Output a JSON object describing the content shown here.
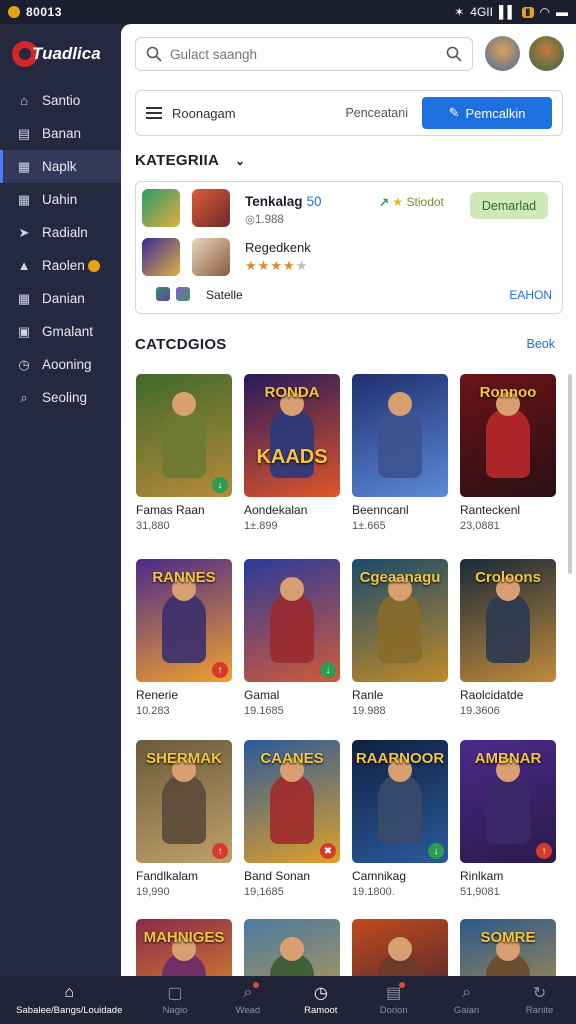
{
  "status": {
    "time": "80013",
    "net": "4GII"
  },
  "app": {
    "name": "Tuadlica"
  },
  "sidebar": {
    "items": [
      {
        "label": "Santio",
        "icon": "home-icon"
      },
      {
        "label": "Banan",
        "icon": "layout-icon"
      },
      {
        "label": "Naplk",
        "icon": "grid-icon",
        "active": true
      },
      {
        "label": "Uahin",
        "icon": "grid-icon"
      },
      {
        "label": "Radialn",
        "icon": "pin-icon"
      },
      {
        "label": "Raolen",
        "icon": "triangle-icon",
        "badge": true
      },
      {
        "label": "Danian",
        "icon": "grid-icon"
      },
      {
        "label": "Gmalant",
        "icon": "image-icon"
      },
      {
        "label": "Aooning",
        "icon": "clock-icon"
      },
      {
        "label": "Seoling",
        "icon": "search-icon"
      }
    ]
  },
  "search": {
    "placeholder": "Gulact saangh"
  },
  "toolbar": {
    "menu_label": "Roonagam",
    "mid_label": "Penceatani",
    "cta_label": "Pemcalkin"
  },
  "featured": {
    "title": "KATEGRIIA",
    "app_name": "Tenkalag",
    "app_tag": "50",
    "meta": "◎1.988",
    "trend_label": "Stiodot",
    "download_label": "Demarlad",
    "second_title": "Regedkenk",
    "rating_filled": 4,
    "rating_total": 5,
    "footer_label": "Satelle",
    "more_label": "EAHON"
  },
  "categories": {
    "title": "CATCDGIOS",
    "see_all": "Beok"
  },
  "games": [
    {
      "name": "Famas Raan",
      "count": "31,880",
      "title": "",
      "bg": [
        "#3e6a2a",
        "#b7893a"
      ],
      "hero": "#6b7a33",
      "chip": "#2e9a52",
      "chip_icon": "↓"
    },
    {
      "name": "Aondekalan",
      "count": "1±.899",
      "title": "KAADS",
      "top": "RONDA",
      "bg": [
        "#261a5c",
        "#e0552a"
      ],
      "hero": "#2a3a7a",
      "chip": "",
      "chip_icon": ""
    },
    {
      "name": "Beenncanl",
      "count": "1±.665",
      "title": "",
      "bg": [
        "#1f2f6e",
        "#5b8ad8"
      ],
      "hero": "#3d5290",
      "chip": "",
      "chip_icon": ""
    },
    {
      "name": "Ranteckenl",
      "count": "23,0881",
      "title": "Ronnoo",
      "bg": [
        "#6a1418",
        "#2a0f14"
      ],
      "hero": "#b8282c",
      "chip": "",
      "chip_icon": ""
    },
    {
      "name": "Renerie",
      "count": "10.283",
      "title": "RANNES",
      "bg": [
        "#4a2a8a",
        "#f0a030"
      ],
      "hero": "#3a2f6e",
      "chip": "#d63a2a",
      "chip_icon": "↑"
    },
    {
      "name": "Gamal",
      "count": "19.1685",
      "title": "",
      "bg": [
        "#2a3a9a",
        "#d05a3a"
      ],
      "hero": "#9a2a30",
      "chip": "#2e9a52",
      "chip_icon": "↓"
    },
    {
      "name": "Ranle",
      "count": "19.988",
      "title": "Cgeaanagu",
      "bg": [
        "#1a4a6a",
        "#c08a2a"
      ],
      "hero": "#8a6a2a",
      "chip": "",
      "chip_icon": ""
    },
    {
      "name": "Raolcidatde",
      "count": "19.3606",
      "title": "Croloons",
      "bg": [
        "#1a2a3a",
        "#c08a3a"
      ],
      "hero": "#2a3850",
      "chip": "",
      "chip_icon": ""
    },
    {
      "name": "Fandlkalam",
      "count": "19,990",
      "title": "SHERMAK",
      "bg": [
        "#6a5a3a",
        "#c0a06a"
      ],
      "hero": "#5a4a3a",
      "chip": "#d63a2a",
      "chip_icon": "↑"
    },
    {
      "name": "Band Sonan",
      "count": "19,1685",
      "title": "CAANES",
      "bg": [
        "#2a5a9a",
        "#e0a02a"
      ],
      "hero": "#a02a2a",
      "chip": "#d63a2a",
      "chip_icon": "✖"
    },
    {
      "name": "Camnikag",
      "count": "19.1800.",
      "title": "RAARNOOR",
      "bg": [
        "#0f2040",
        "#2a5a9a"
      ],
      "hero": "#3a4a6a",
      "chip": "#2e9a52",
      "chip_icon": "↓"
    },
    {
      "name": "Rinlkam",
      "count": "51,9081",
      "title": "AMBNAR",
      "bg": [
        "#4a2a8a",
        "#2a1a4a"
      ],
      "hero": "#3a2a6a",
      "chip": "#d63a2a",
      "chip_icon": "↑"
    },
    {
      "name": "",
      "count": "",
      "title": "MAHNIGES",
      "bg": [
        "#8a2a4a",
        "#f0a02a"
      ],
      "hero": "#6a2a6a",
      "chip": "",
      "chip_icon": ""
    },
    {
      "name": "",
      "count": "",
      "title": "",
      "bg": [
        "#4a7aa0",
        "#d0a040"
      ],
      "hero": "#3a5a30",
      "chip": "",
      "chip_icon": ""
    },
    {
      "name": "",
      "count": "",
      "title": "",
      "bg": [
        "#c04a20",
        "#2a1a30"
      ],
      "hero": "#6a3a2a",
      "chip": "",
      "chip_icon": ""
    },
    {
      "name": "",
      "count": "",
      "title": "SOMRE",
      "bg": [
        "#2a5a8a",
        "#d09a40"
      ],
      "hero": "#6a4a2a",
      "chip": "",
      "chip_icon": ""
    }
  ],
  "bottom_nav": [
    {
      "label": "Sabalee/Bangs/Louidade",
      "icon": "home-icon",
      "kind": "home"
    },
    {
      "label": "Nagio",
      "icon": "square-icon",
      "kind": ""
    },
    {
      "label": "Wead",
      "icon": "search-icon",
      "kind": "",
      "dot": true
    },
    {
      "label": "Ramoot",
      "icon": "clock-icon",
      "kind": "cur"
    },
    {
      "label": "Dorion",
      "icon": "bag-icon",
      "kind": "",
      "dot": true
    },
    {
      "label": "Gaian",
      "icon": "search-icon",
      "kind": ""
    },
    {
      "label": "Ranite",
      "icon": "refresh-icon",
      "kind": ""
    }
  ]
}
